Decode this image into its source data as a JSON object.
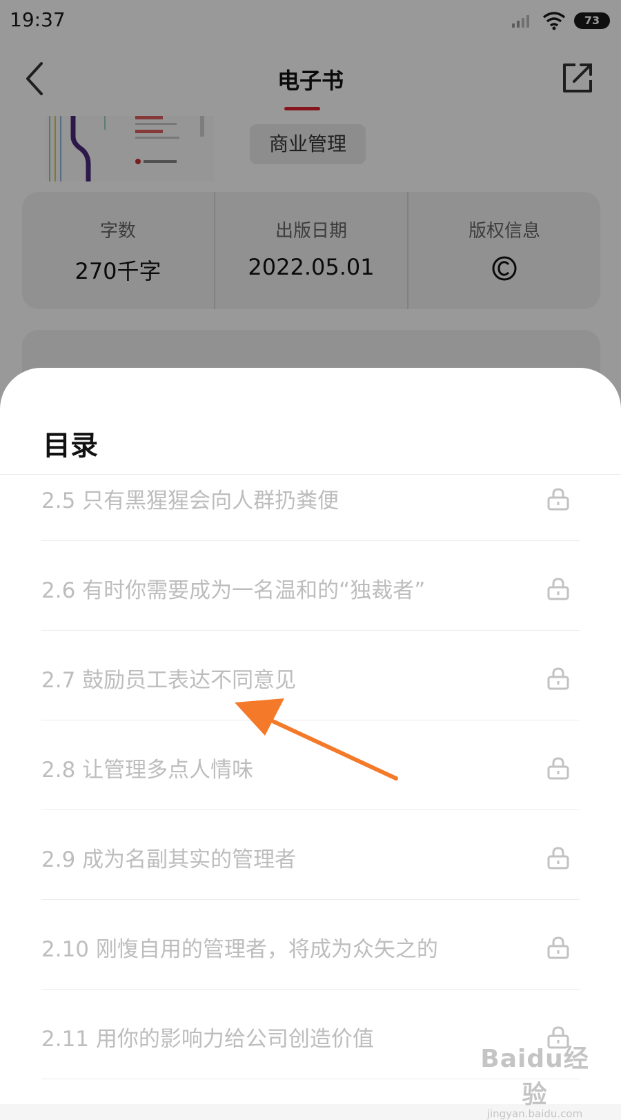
{
  "status_bar": {
    "time": "19:37",
    "battery": "73"
  },
  "header": {
    "title": "电子书"
  },
  "book": {
    "category": "商业管理"
  },
  "info": [
    {
      "label": "字数",
      "value": "270千字"
    },
    {
      "label": "出版日期",
      "value": "2022.05.01"
    },
    {
      "label": "版权信息",
      "value": ""
    }
  ],
  "sheet": {
    "title": "目录",
    "items": [
      {
        "label": "2.5 只有黑猩猩会向人群扔粪便",
        "locked": true
      },
      {
        "label": "2.6 有时你需要成为一名温和的“独裁者”",
        "locked": true
      },
      {
        "label": "2.7 鼓励员工表达不同意见",
        "locked": true
      },
      {
        "label": "2.8 让管理多点人情味",
        "locked": true
      },
      {
        "label": "2.9 成为名副其实的管理者",
        "locked": true
      },
      {
        "label": "2.10 刚愎自用的管理者，将成为众矢之的",
        "locked": true
      },
      {
        "label": "2.11 用你的影响力给公司创造价值",
        "locked": true
      }
    ]
  },
  "watermark": {
    "logo": "Baidu经验",
    "url": "jingyan.baidu.com"
  },
  "colors": {
    "accent": "#e0252e",
    "arrow": "#f47a2a",
    "locked_text": "#bdbdbd"
  }
}
